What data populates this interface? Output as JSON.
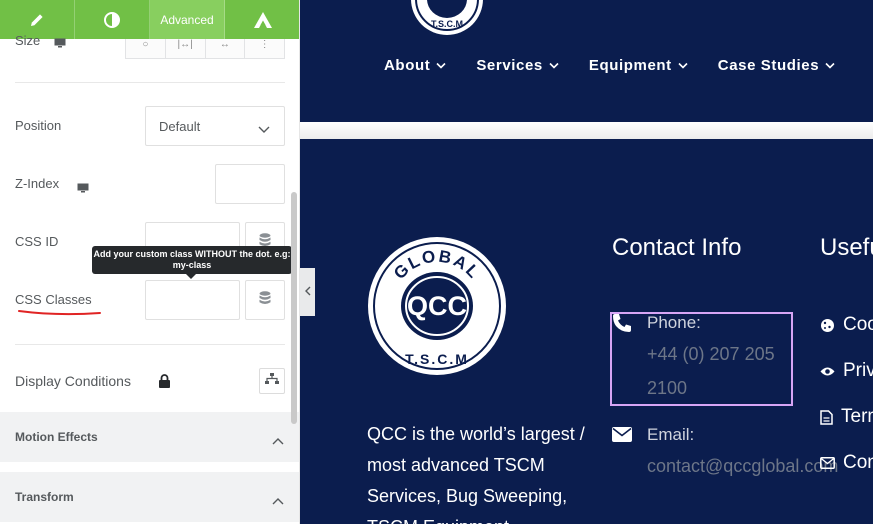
{
  "panel": {
    "tabs": [
      {
        "name": "content",
        "icon": "pencil-icon"
      },
      {
        "name": "style",
        "icon": "contrast-icon"
      },
      {
        "name": "advanced",
        "label": "Advanced"
      },
      {
        "name": "pro",
        "icon": "a-logo-icon"
      }
    ],
    "size_label": "Size",
    "position": {
      "label": "Position",
      "value": "Default"
    },
    "z_index": {
      "label": "Z-Index",
      "value": ""
    },
    "css_id": {
      "label": "CSS ID",
      "value": ""
    },
    "css_classes": {
      "label": "CSS Classes",
      "value": ""
    },
    "tooltip": "Add your custom class WITHOUT the dot. e.g: my-class",
    "display_conditions": {
      "label": "Display Conditions"
    },
    "sections": [
      {
        "title": "Motion Effects"
      },
      {
        "title": "Transform"
      }
    ],
    "accent_color": "#71c046",
    "annotation_color": "#e02424"
  },
  "site": {
    "header_logo_text": "T.S.C.M",
    "nav": [
      {
        "label": "About"
      },
      {
        "label": "Services"
      },
      {
        "label": "Equipment"
      },
      {
        "label": "Case Studies"
      }
    ],
    "logo": {
      "top": "GLOBAL",
      "center": "QCC",
      "bottom": "T.S.C.M"
    },
    "about_text": "QCC is the world’s largest / most advanced TSCM Services, Bug Sweeping, TSCM Equipment ...",
    "contact_heading": "Contact Info",
    "useful_heading": "Useful Links",
    "phone": {
      "label": "Phone:",
      "value": "+44 (0) 207 205 2100"
    },
    "email": {
      "label": "Email:",
      "value": "contact@qccglobal.com"
    },
    "useful_links": [
      {
        "label": "Cookie Policy",
        "icon": "cookie-icon"
      },
      {
        "label": "Privacy Policy",
        "icon": "eye-icon"
      },
      {
        "label": "Terms",
        "icon": "document-icon"
      },
      {
        "label": "Contact",
        "icon": "envelope-icon"
      }
    ],
    "colors": {
      "navy": "#0b1d4e",
      "selection": "#d7a5f5"
    }
  }
}
